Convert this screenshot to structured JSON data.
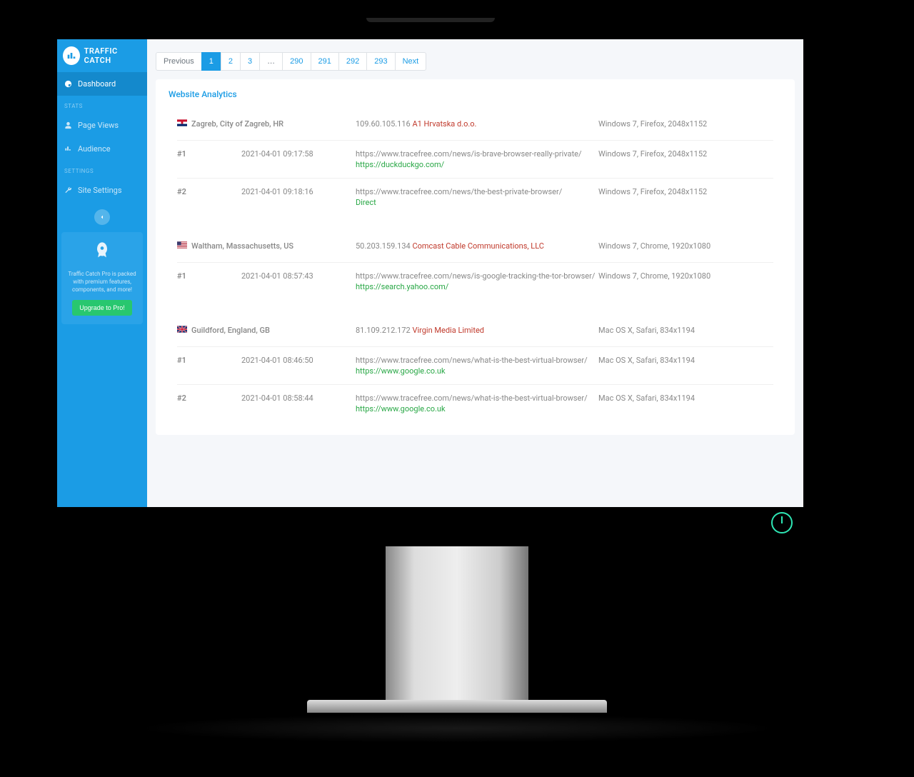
{
  "brand": "TRAFFIC CATCH",
  "sidebar": {
    "dashboard": "Dashboard",
    "header_stats": "STATS",
    "page_views": "Page Views",
    "audience": "Audience",
    "header_settings": "SETTINGS",
    "site_settings": "Site Settings"
  },
  "promo": {
    "text": "Traffic Catch Pro is packed with premium features, components, and more!",
    "button": "Upgrade to Pro!"
  },
  "pagination": {
    "previous": "Previous",
    "pages": [
      "1",
      "2",
      "3"
    ],
    "ellipsis": "…",
    "pages_end": [
      "290",
      "291",
      "292",
      "293"
    ],
    "next": "Next"
  },
  "card_title": "Website Analytics",
  "visitors": [
    {
      "flag": "hr",
      "location": "Zagreb, City of Zagreb, HR",
      "ip": "109.60.105.116",
      "isp": "A1 Hrvatska d.o.o.",
      "device": "Windows 7, Firefox, 2048x1152",
      "visits": [
        {
          "num": "#1",
          "time": "2021-04-01 09:17:58",
          "url": "https://www.tracefree.com/news/is-brave-browser-really-private/",
          "ref": "https://duckduckgo.com/",
          "device": "Windows 7, Firefox, 2048x1152"
        },
        {
          "num": "#2",
          "time": "2021-04-01 09:18:16",
          "url": "https://www.tracefree.com/news/the-best-private-browser/",
          "ref": "Direct",
          "device": "Windows 7, Firefox, 2048x1152"
        }
      ]
    },
    {
      "flag": "us",
      "location": "Waltham, Massachusetts, US",
      "ip": "50.203.159.134",
      "isp": "Comcast Cable Communications, LLC",
      "device": "Windows 7, Chrome, 1920x1080",
      "visits": [
        {
          "num": "#1",
          "time": "2021-04-01 08:57:43",
          "url": "https://www.tracefree.com/news/is-google-tracking-the-tor-browser/",
          "ref": "https://search.yahoo.com/",
          "device": "Windows 7, Chrome, 1920x1080"
        }
      ]
    },
    {
      "flag": "gb",
      "location": "Guildford, England, GB",
      "ip": "81.109.212.172",
      "isp": "Virgin Media Limited",
      "device": "Mac OS X, Safari, 834x1194",
      "visits": [
        {
          "num": "#1",
          "time": "2021-04-01 08:46:50",
          "url": "https://www.tracefree.com/news/what-is-the-best-virtual-browser/",
          "ref": "https://www.google.co.uk",
          "device": "Mac OS X, Safari, 834x1194"
        },
        {
          "num": "#2",
          "time": "2021-04-01 08:58:44",
          "url": "https://www.tracefree.com/news/what-is-the-best-virtual-browser/",
          "ref": "https://www.google.co.uk",
          "device": "Mac OS X, Safari, 834x1194"
        }
      ]
    }
  ]
}
